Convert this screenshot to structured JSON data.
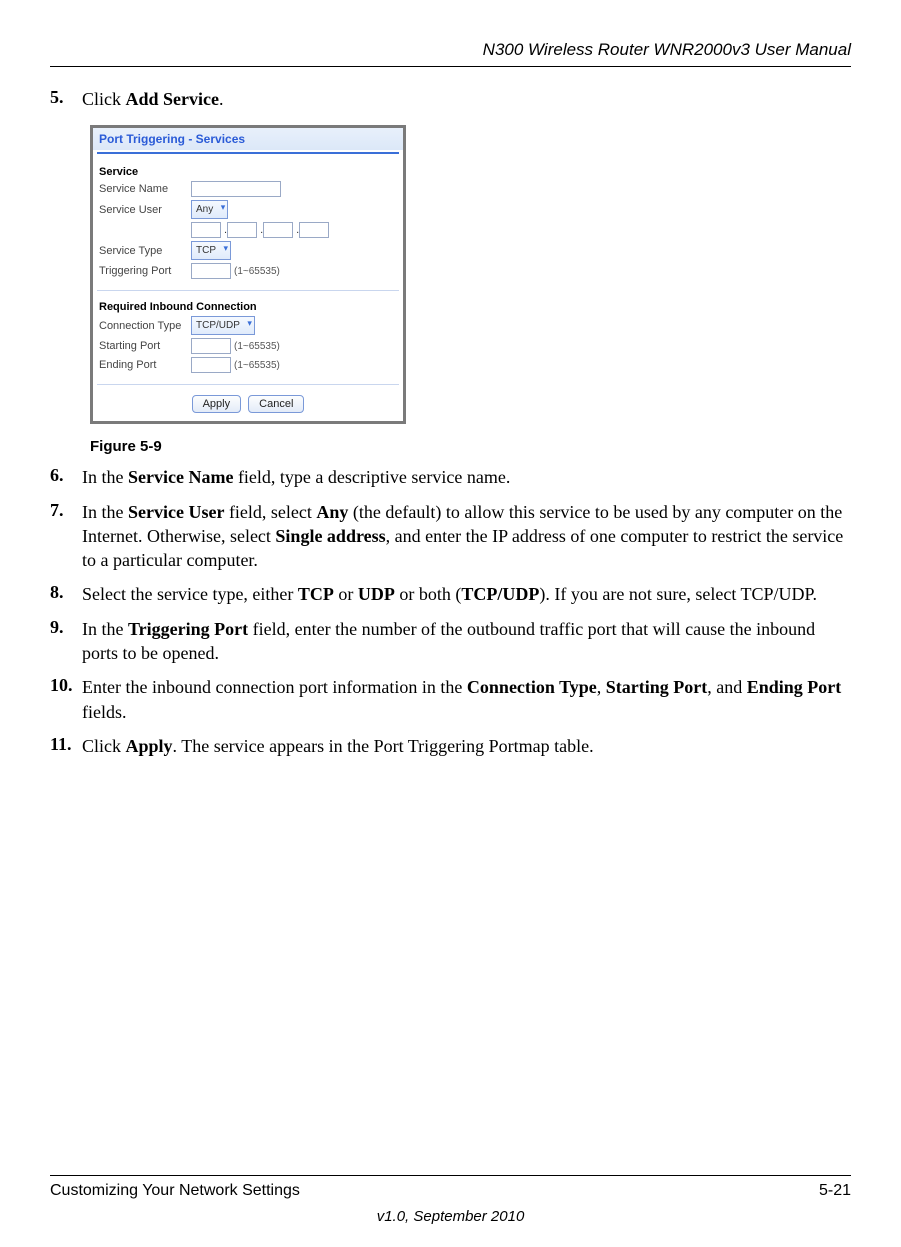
{
  "header": {
    "title": "N300 Wireless Router WNR2000v3 User Manual"
  },
  "steps": {
    "s5": {
      "num": "5.",
      "prefix": "Click ",
      "b1": "Add Service",
      "suffix": "."
    },
    "s6": {
      "num": "6.",
      "prefix": "In the ",
      "b1": "Service Name",
      "suffix": " field, type a descriptive service name."
    },
    "s7": {
      "num": "7.",
      "prefix": "In the ",
      "b1": "Service User",
      "mid1": " field, select ",
      "b2": "Any",
      "mid2": " (the default) to allow this service to be used by any computer on the Internet. Otherwise, select ",
      "b3": "Single address",
      "suffix": ", and enter the IP address of one computer to restrict the service to a particular computer."
    },
    "s8": {
      "num": "8.",
      "prefix": "Select the service type, either ",
      "b1": "TCP",
      "mid1": " or ",
      "b2": "UDP",
      "mid2": " or both (",
      "b3": "TCP/UDP",
      "suffix": "). If you are not sure, select TCP/UDP."
    },
    "s9": {
      "num": "9.",
      "prefix": "In the ",
      "b1": "Triggering Port",
      "suffix": " field, enter the number of the outbound traffic port that will cause the inbound ports to be opened."
    },
    "s10": {
      "num": "10.",
      "prefix": "Enter the inbound connection port information in the ",
      "b1": "Connection Type",
      "mid1": ", ",
      "b2": "Starting Port",
      "mid2": ", and ",
      "b3": "Ending Port",
      "suffix": " fields."
    },
    "s11": {
      "num": "11.",
      "prefix": "Click ",
      "b1": "Apply",
      "suffix": ". The service appears in the Port Triggering Portmap table."
    }
  },
  "figure": {
    "caption": "Figure 5-9",
    "title": "Port Triggering - Services",
    "section_service": "Service",
    "label_service_name": "Service Name",
    "label_service_user": "Service User",
    "select_service_user": "Any",
    "label_service_type": "Service Type",
    "select_service_type": "TCP",
    "label_triggering_port": "Triggering Port",
    "hint_range": "(1~65535)",
    "section_inbound": "Required Inbound Connection",
    "label_connection_type": "Connection Type",
    "select_connection_type": "TCP/UDP",
    "label_starting_port": "Starting Port",
    "label_ending_port": "Ending Port",
    "btn_apply": "Apply",
    "btn_cancel": "Cancel",
    "ip_dot": "."
  },
  "footer": {
    "left": "Customizing Your Network Settings",
    "right": "5-21",
    "center": "v1.0, September 2010"
  }
}
